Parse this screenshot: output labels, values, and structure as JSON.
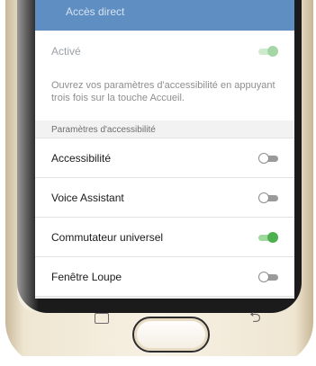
{
  "header": {
    "title": "Accès direct"
  },
  "active_row": {
    "label": "Activé",
    "on": true
  },
  "description": "Ouvrez vos paramètres d'accessibilité en appuyant trois fois sur la touche Accueil.",
  "section": {
    "title": "Paramètres d'accessibilité"
  },
  "items": [
    {
      "label": "Accessibilité",
      "on": false
    },
    {
      "label": "Voice Assistant",
      "on": false
    },
    {
      "label": "Commutateur universel",
      "on": true
    },
    {
      "label": "Fenêtre Loupe",
      "on": false
    }
  ],
  "colors": {
    "accent": "#4caf50",
    "header": "#5e8ec2",
    "frame": "#efe6d2"
  },
  "nav": {
    "recent_icon": "recent-apps-icon",
    "back_icon": "back-arrow-icon"
  }
}
